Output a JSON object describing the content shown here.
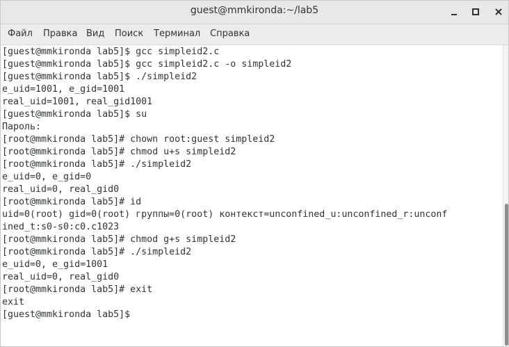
{
  "window": {
    "title": "guest@mmkironda:~/lab5"
  },
  "menu": {
    "items": [
      "Файл",
      "Правка",
      "Вид",
      "Поиск",
      "Терминал",
      "Справка"
    ]
  },
  "terminal": {
    "lines": [
      "[guest@mmkironda lab5]$ gcc simpleid2.c",
      "[guest@mmkironda lab5]$ gcc simpleid2.c -o simpleid2",
      "[guest@mmkironda lab5]$ ./simpleid2",
      "e_uid=1001, e_gid=1001",
      "real_uid=1001, real_gid1001",
      "[guest@mmkironda lab5]$ su",
      "Пароль:",
      "[root@mmkironda lab5]# chown root:guest simpleid2",
      "[root@mmkironda lab5]# chmod u+s simpleid2",
      "[root@mmkironda lab5]# ./simpleid2",
      "e_uid=0, e_gid=0",
      "real_uid=0, real_gid0",
      "[root@mmkironda lab5]# id",
      "uid=0(root) gid=0(root) группы=0(root) контекст=unconfined_u:unconfined_r:unconf",
      "ined_t:s0-s0:c0.c1023",
      "[root@mmkironda lab5]# chmod g+s simpleid2",
      "[root@mmkironda lab5]# ./simpleid2",
      "e_uid=0, e_gid=1001",
      "real_uid=0, real_gid0",
      "[root@mmkironda lab5]# exit",
      "exit",
      "[guest@mmkironda lab5]$ "
    ]
  }
}
